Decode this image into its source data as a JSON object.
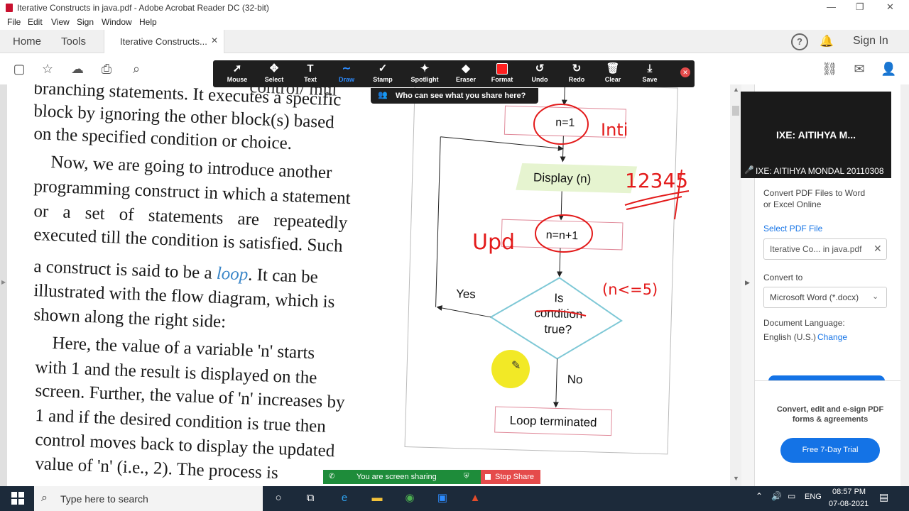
{
  "window": {
    "title": "Iterative Constructs in java.pdf - Adobe Acrobat Reader DC (32-bit)",
    "controls": {
      "minimize": "—",
      "restore": "❐",
      "close": "✕"
    }
  },
  "menu": [
    "File",
    "Edit",
    "View",
    "Sign",
    "Window",
    "Help"
  ],
  "tabs": {
    "home": "Home",
    "tools": "Tools",
    "document": "Iterative Constructs...",
    "close": "✕",
    "sign_in": "Sign In"
  },
  "zoom_toolbar": {
    "items": [
      {
        "label": "Mouse",
        "icon": "cursor-icon",
        "glyph": "➚"
      },
      {
        "label": "Select",
        "icon": "move-icon",
        "glyph": "✥"
      },
      {
        "label": "Text",
        "icon": "text-icon",
        "glyph": "T"
      },
      {
        "label": "Draw",
        "icon": "draw-icon",
        "glyph": "∼"
      },
      {
        "label": "Stamp",
        "icon": "stamp-icon",
        "glyph": "✓"
      },
      {
        "label": "Spotlight",
        "icon": "spotlight-icon",
        "glyph": "✦"
      },
      {
        "label": "Eraser",
        "icon": "eraser-icon",
        "glyph": "◆"
      },
      {
        "label": "Format",
        "icon": "format-icon",
        "glyph": ""
      },
      {
        "label": "Undo",
        "icon": "undo-icon",
        "glyph": "↺"
      },
      {
        "label": "Redo",
        "icon": "redo-icon",
        "glyph": "↻"
      },
      {
        "label": "Clear",
        "icon": "trash-icon",
        "glyph": "🗑"
      },
      {
        "label": "Save",
        "icon": "save-icon",
        "glyph": "⤓"
      }
    ],
    "active": "Draw",
    "who_can_see": "Who can see what you share here?"
  },
  "page": {
    "lines": [
      "branching statements. It executes a specific",
      "block by ignoring the other block(s) based",
      "on the specified condition or choice.",
      "Now, we are going to introduce another",
      "programming construct in which a statement",
      "or a set of statements are repeatedly",
      "executed till the condition is satisfied. Such",
      "a construct is said to be a ",
      "illustrated with the flow diagram, which is",
      "shown along the right side:",
      "Here, the value of a variable 'n' starts",
      "with 1 and the result is displayed on the",
      "screen. Further, the value of 'n' increases by",
      "1 and if the desired condition is true then",
      "control moves back to display the updated",
      "value of 'n' (i.e., 2). The process is"
    ],
    "partial_top": "control/ mul",
    "loop_word": "loop",
    "after_loop": ". It can be"
  },
  "flowchart": {
    "init": "n=1",
    "display": "Display (n)",
    "update": "n=n+1",
    "decision_lines": [
      "Is",
      "condition",
      "true?"
    ],
    "yes": "Yes",
    "no": "No",
    "terminate": "Loop terminated"
  },
  "annotations": {
    "init_note": "Inti",
    "output_note": "12345",
    "update_note": "Upd",
    "condition_note": "(n<=5)",
    "ink_color": "#e31b1b"
  },
  "right_pane": {
    "convert_desc": [
      "Convert PDF Files to Word",
      "or Excel Online"
    ],
    "select_file": "Select PDF File",
    "file_name": "Iterative Co... in java.pdf",
    "convert_to": "Convert to",
    "format": "Microsoft Word (*.docx)",
    "doc_lang": "Document Language:",
    "lang_value": "English (U.S.)",
    "change": "Change",
    "promo": [
      "Convert, edit and e-sign PDF",
      "forms & agreements"
    ],
    "trial_btn": "Free 7-Day Trial",
    "accent": "#1473e6"
  },
  "video": {
    "name": "IXE: AITIHYA M...",
    "caption": "IXE: AITIHYA MONDAL 20110308"
  },
  "sharing": {
    "status": "You are screen sharing",
    "stop": "Stop Share"
  },
  "taskbar": {
    "search_placeholder": "Type here to search",
    "lang": "ENG",
    "time": "08:57 PM",
    "date": "07-08-2021"
  }
}
